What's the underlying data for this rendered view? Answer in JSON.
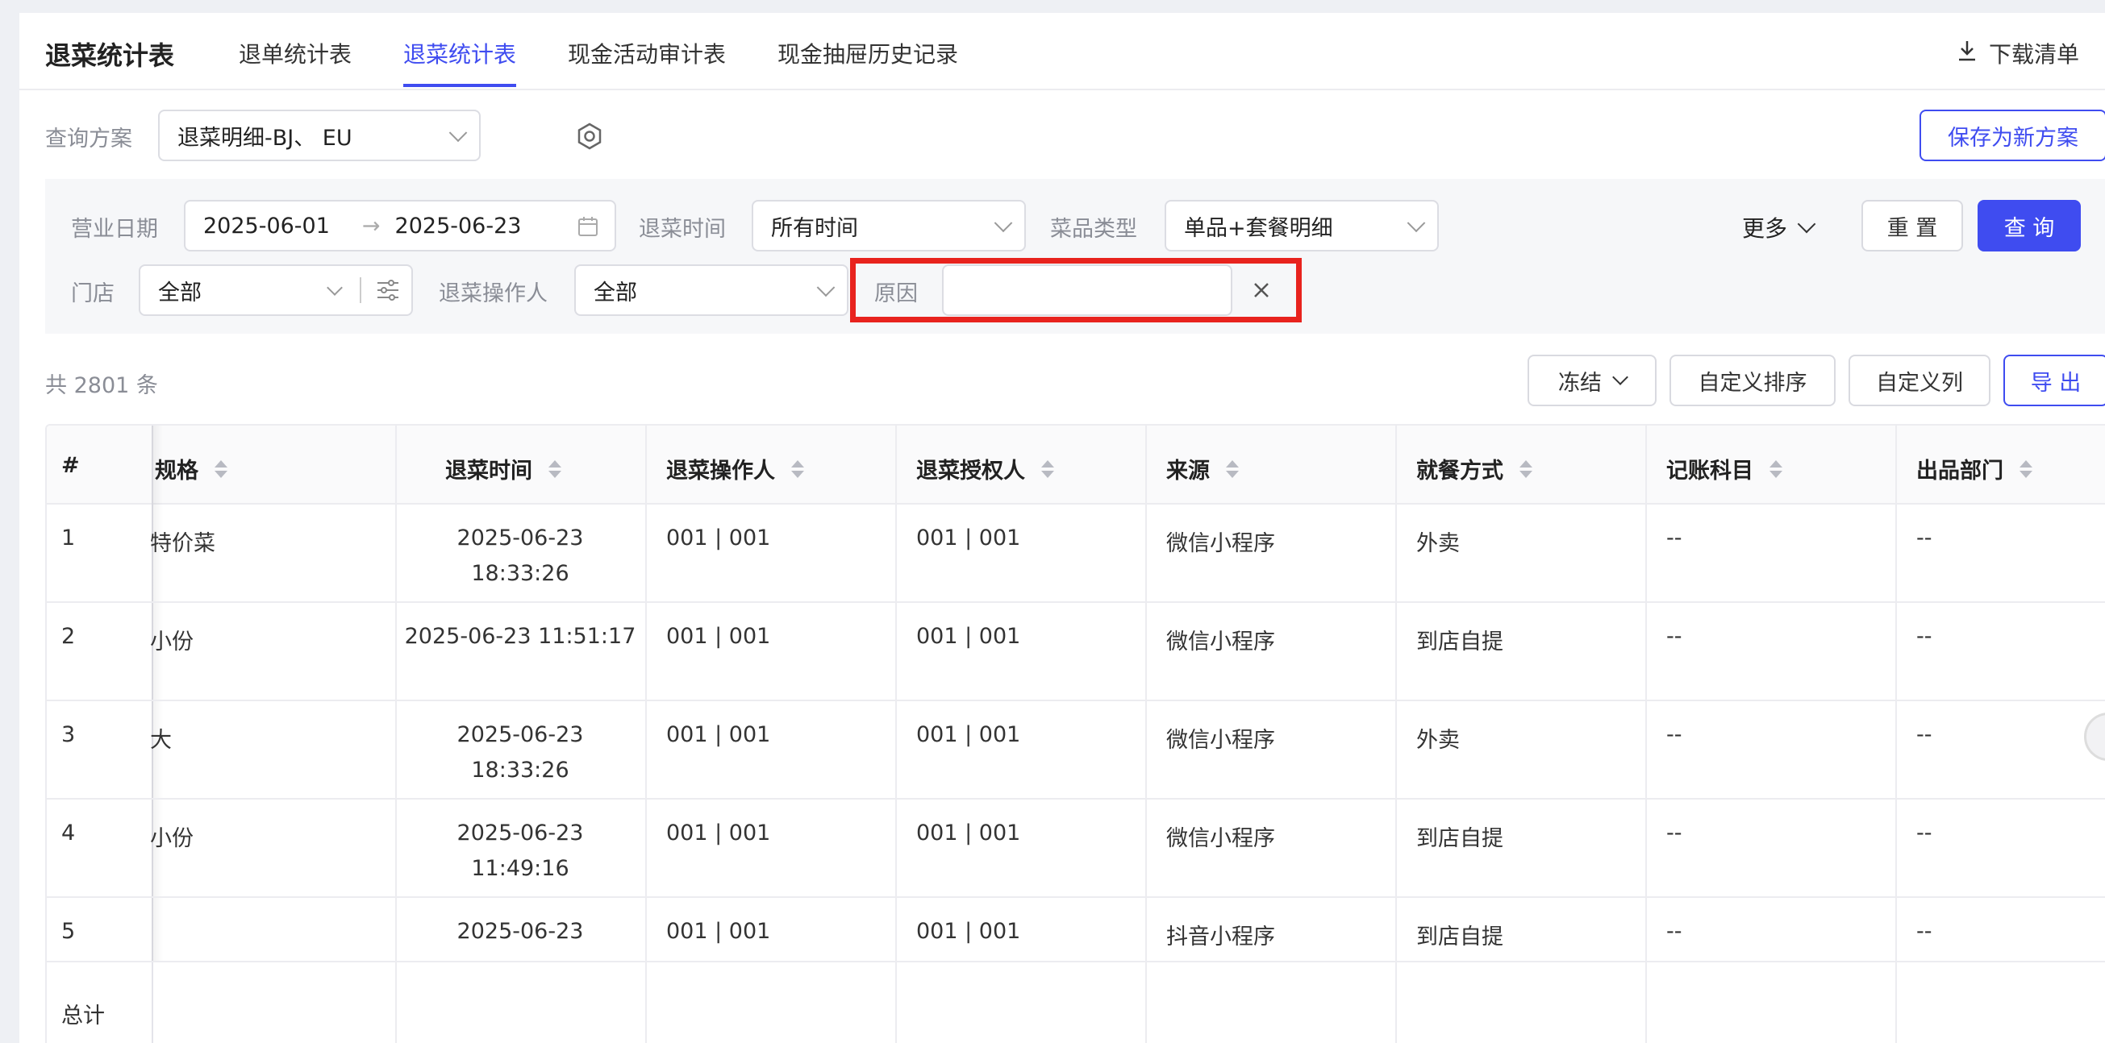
{
  "header": {
    "title": "退菜统计表",
    "tabs": [
      "退单统计表",
      "退菜统计表",
      "现金活动审计表",
      "现金抽屉历史记录"
    ],
    "active_tab": "退菜统计表",
    "download_label": "下载清单"
  },
  "query_plan": {
    "label": "查询方案",
    "value": "退菜明细-BJ、 EU",
    "save_label": "保存为新方案"
  },
  "filters": {
    "business_date_label": "营业日期",
    "date_start": "2025-06-01",
    "date_arrow": "→",
    "date_end": "2025-06-23",
    "return_time_label": "退菜时间",
    "return_time_value": "所有时间",
    "dish_type_label": "菜品类型",
    "dish_type_value": "单品+套餐明细",
    "more_label": "更多",
    "reset_label": "重 置",
    "query_label": "查 询",
    "store_label": "门店",
    "store_value": "全部",
    "operator_label": "退菜操作人",
    "operator_value": "全部",
    "reason_label": "原因",
    "reason_value": ""
  },
  "toolbar": {
    "total": "共 2801 条",
    "freeze_label": "冻结",
    "custom_sort_label": "自定义排序",
    "custom_columns_label": "自定义列",
    "export_label": "导 出"
  },
  "table": {
    "headers": [
      "#",
      "规格",
      "退菜时间",
      "退菜操作人",
      "退菜授权人",
      "来源",
      "就餐方式",
      "记账科目",
      "出品部门"
    ],
    "rows": [
      {
        "no": "1",
        "spec": "特价菜",
        "time1": "2025-06-23",
        "time2": "18:33:26",
        "operator": "001 | 001",
        "authorizer": "001 | 001",
        "source": "微信小程序",
        "dining": "外卖",
        "account": "--",
        "dept": "--"
      },
      {
        "no": "2",
        "spec": "小份",
        "time1": "2025-06-23 11:51:17",
        "time2": "",
        "operator": "001 | 001",
        "authorizer": "001 | 001",
        "source": "微信小程序",
        "dining": "到店自提",
        "account": "--",
        "dept": "--"
      },
      {
        "no": "3",
        "spec": "大",
        "time1": "2025-06-23",
        "time2": "18:33:26",
        "operator": "001 | 001",
        "authorizer": "001 | 001",
        "source": "微信小程序",
        "dining": "外卖",
        "account": "--",
        "dept": "--"
      },
      {
        "no": "4",
        "spec": "小份",
        "time1": "2025-06-23",
        "time2": "11:49:16",
        "operator": "001 | 001",
        "authorizer": "001 | 001",
        "source": "微信小程序",
        "dining": "到店自提",
        "account": "--",
        "dept": "--"
      },
      {
        "no": "5",
        "spec": "",
        "time1": "2025-06-23",
        "time2": "",
        "operator": "001 | 001",
        "authorizer": "001 | 001",
        "source": "抖音小程序",
        "dining": "到店自提",
        "account": "--",
        "dept": "--"
      }
    ],
    "total_label": "总计"
  },
  "colors": {
    "accent": "#3f4cf0",
    "highlight_box": "#e8231e"
  }
}
